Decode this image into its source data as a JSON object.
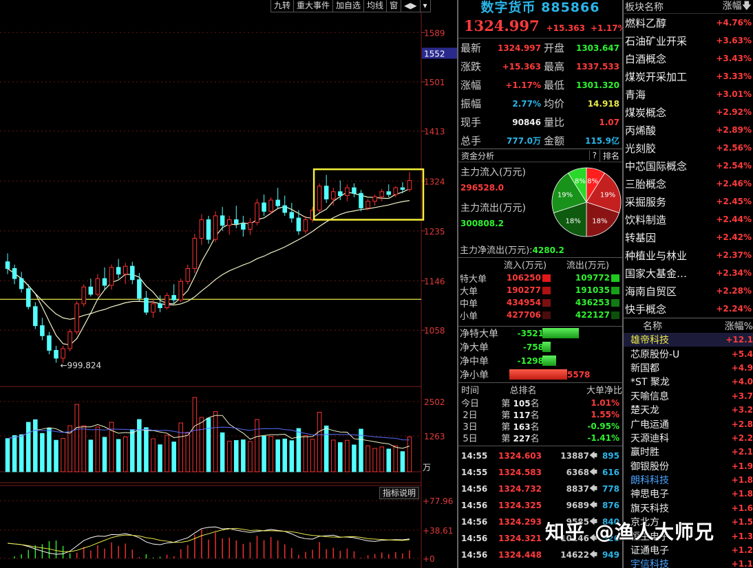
{
  "toolbar": [
    "九转",
    "重大事件",
    "加自选",
    "均线",
    "窗",
    "◀▶",
    "▾"
  ],
  "indicator_button": "指标说明",
  "chart_data": {
    "type": "candlestick",
    "price_axis": {
      "ylim": [
        960,
        1620
      ],
      "ticks": [
        "1589",
        "1501",
        "1413",
        "1324",
        "1235",
        "1146",
        "1058"
      ],
      "highlight_label": "1552"
    },
    "low_annotation": "999.824",
    "reference_line": 1113,
    "candles": [
      [
        1180,
        1195,
        1158,
        1168
      ],
      [
        1168,
        1175,
        1140,
        1150
      ],
      [
        1150,
        1162,
        1125,
        1132
      ],
      [
        1132,
        1140,
        1095,
        1100
      ],
      [
        1100,
        1108,
        1060,
        1066
      ],
      [
        1066,
        1080,
        1040,
        1048
      ],
      [
        1048,
        1055,
        1015,
        1022
      ],
      [
        1022,
        1030,
        1000,
        1008
      ],
      [
        1008,
        1030,
        1000,
        1025
      ],
      [
        1025,
        1060,
        1020,
        1055
      ],
      [
        1055,
        1110,
        1050,
        1105
      ],
      [
        1105,
        1140,
        1100,
        1135
      ],
      [
        1135,
        1150,
        1118,
        1122
      ],
      [
        1122,
        1158,
        1118,
        1150
      ],
      [
        1150,
        1170,
        1130,
        1138
      ],
      [
        1138,
        1175,
        1130,
        1170
      ],
      [
        1170,
        1185,
        1150,
        1158
      ],
      [
        1158,
        1178,
        1140,
        1172
      ],
      [
        1172,
        1180,
        1140,
        1148
      ],
      [
        1148,
        1160,
        1110,
        1115
      ],
      [
        1115,
        1128,
        1085,
        1090
      ],
      [
        1090,
        1112,
        1080,
        1105
      ],
      [
        1105,
        1120,
        1090,
        1098
      ],
      [
        1098,
        1125,
        1095,
        1120
      ],
      [
        1120,
        1140,
        1105,
        1112
      ],
      [
        1112,
        1150,
        1108,
        1145
      ],
      [
        1145,
        1175,
        1140,
        1168
      ],
      [
        1168,
        1230,
        1160,
        1222
      ],
      [
        1222,
        1265,
        1210,
        1255
      ],
      [
        1255,
        1262,
        1212,
        1220
      ],
      [
        1220,
        1270,
        1215,
        1262
      ],
      [
        1262,
        1278,
        1235,
        1245
      ],
      [
        1245,
        1262,
        1228,
        1255
      ],
      [
        1255,
        1280,
        1240,
        1248
      ],
      [
        1248,
        1262,
        1225,
        1238
      ],
      [
        1238,
        1258,
        1228,
        1250
      ],
      [
        1250,
        1292,
        1245,
        1285
      ],
      [
        1285,
        1300,
        1262,
        1270
      ],
      [
        1270,
        1295,
        1265,
        1290
      ],
      [
        1290,
        1312,
        1275,
        1280
      ],
      [
        1280,
        1298,
        1262,
        1268
      ],
      [
        1268,
        1285,
        1250,
        1258
      ],
      [
        1258,
        1272,
        1228,
        1235
      ],
      [
        1235,
        1262,
        1230,
        1255
      ],
      [
        1255,
        1278,
        1250,
        1272
      ],
      [
        1272,
        1320,
        1268,
        1315
      ],
      [
        1315,
        1335,
        1285,
        1292
      ],
      [
        1292,
        1312,
        1280,
        1305
      ],
      [
        1305,
        1325,
        1290,
        1298
      ],
      [
        1298,
        1318,
        1288,
        1312
      ],
      [
        1312,
        1320,
        1295,
        1302
      ],
      [
        1302,
        1308,
        1270,
        1276
      ],
      [
        1276,
        1292,
        1272,
        1288
      ],
      [
        1288,
        1300,
        1280,
        1296
      ],
      [
        1296,
        1310,
        1288,
        1305
      ],
      [
        1305,
        1318,
        1295,
        1300
      ],
      [
        1300,
        1315,
        1295,
        1312
      ],
      [
        1312,
        1322,
        1302,
        1309
      ],
      [
        1309,
        1340,
        1305,
        1325
      ]
    ],
    "volume_axis": {
      "ticks": [
        "2502",
        "1263"
      ],
      "unit": "万"
    },
    "indicator_axis": {
      "ticks": [
        "+77.96",
        "+38.61",
        "+0"
      ]
    }
  },
  "quote": {
    "title": "数字货币 885866",
    "price": "1324.997",
    "change": "+15.363",
    "pct": "+1.17%",
    "rows": [
      {
        "l": "最新",
        "v": "1324.997",
        "vc": "red",
        "l2": "开盘",
        "v2": "1303.647",
        "v2c": "green"
      },
      {
        "l": "涨跌",
        "v": "+15.363",
        "vc": "red",
        "l2": "最高",
        "v2": "1337.533",
        "v2c": "red"
      },
      {
        "l": "涨幅",
        "v": "+1.17%",
        "vc": "red",
        "l2": "最低",
        "v2": "1301.320",
        "v2c": "green"
      },
      {
        "l": "振幅",
        "v": "2.77%",
        "vc": "cyan",
        "l2": "均价",
        "v2": "14.918",
        "v2c": "yellow"
      },
      {
        "l": "现手",
        "v": "90846",
        "vc": "white",
        "l2": "量比",
        "v2": "1.07",
        "v2c": "red"
      },
      {
        "l": "总手",
        "v": "777.0万",
        "vc": "cyan",
        "l2": "金额",
        "v2": "115.9亿",
        "v2c": "cyan"
      }
    ]
  },
  "fund": {
    "header": "资金分析",
    "help": "?",
    "rank": "排名",
    "inflow_label": "主力流入(万元)",
    "inflow": "296528.0",
    "outflow_label": "主力流出(万元)",
    "outflow": "300808.2",
    "net_label": "主力净流出(万元):",
    "net": "4280.2",
    "pie": [
      {
        "label": "8%",
        "value": 8,
        "color": "#ff1f1f"
      },
      {
        "label": "19%",
        "value": 19,
        "color": "#c42020"
      },
      {
        "label": "18%",
        "value": 18,
        "color": "#8a1414"
      },
      {
        "label": "18%",
        "value": 18,
        "color": "#0e5a0e"
      },
      {
        "label": "19%",
        "value": 19,
        "color": "#18921a"
      },
      {
        "label": "8%",
        "value": 8,
        "color": "#2ad82a"
      }
    ]
  },
  "flow_table": {
    "headers": [
      "流入(万元)",
      "流出(万元)"
    ],
    "rows": [
      {
        "n": "特大单",
        "a": "106250",
        "b": "109772",
        "sq1": "#e01818",
        "sq2": "#1ec81e"
      },
      {
        "n": "大单",
        "a": "190277",
        "b": "191035",
        "sq1": "#b01212",
        "sq2": "#17a017"
      },
      {
        "n": "中单",
        "a": "434954",
        "b": "436253",
        "sq1": "#7a1010",
        "sq2": "#127a12"
      },
      {
        "n": "小单",
        "a": "427706",
        "b": "422127",
        "sq1": "#4a0c0c",
        "sq2": "#0c500c"
      }
    ]
  },
  "net_table": [
    {
      "n": "净特大单",
      "v": "-3521",
      "vc": "green",
      "bar": 0.62,
      "side": "green"
    },
    {
      "n": "净大单",
      "v": "-758",
      "vc": "green",
      "bar": 0.14,
      "side": "green"
    },
    {
      "n": "净中单",
      "v": "-1298",
      "vc": "green",
      "bar": 0.23,
      "side": "green"
    },
    {
      "n": "净小单",
      "v": "5578",
      "vc": "red",
      "bar": 1.0,
      "side": "red"
    }
  ],
  "rank_table": {
    "headers": [
      "时间",
      "总排名",
      "大单净比"
    ],
    "rows": [
      {
        "d": "今日",
        "r": "105",
        "p": "1.01%",
        "pc": "red"
      },
      {
        "d": "2日",
        "r": "117",
        "p": "1.55%",
        "pc": "red"
      },
      {
        "d": "3日",
        "r": "163",
        "p": "-0.95%",
        "pc": "green"
      },
      {
        "d": "5日",
        "r": "227",
        "p": "-1.41%",
        "pc": "green"
      }
    ],
    "prefix": "第",
    "suffix": "名"
  },
  "ticks": [
    {
      "t": "14:55",
      "p": "1324.603",
      "v": "13887",
      "c": "895"
    },
    {
      "t": "14:55",
      "p": "1324.583",
      "v": "6368",
      "c": "616"
    },
    {
      "t": "14:56",
      "p": "1324.732",
      "v": "8837",
      "c": "778"
    },
    {
      "t": "14:56",
      "p": "1324.325",
      "v": "9689",
      "c": "876"
    },
    {
      "t": "14:56",
      "p": "1324.293",
      "v": "9585",
      "c": "840"
    },
    {
      "t": "14:56",
      "p": "1324.321",
      "v": "10146",
      "c": "926"
    },
    {
      "t": "14:56",
      "p": "1324.448",
      "v": "14622",
      "c": "949"
    }
  ],
  "sector": {
    "headers": [
      "板块名称",
      "涨幅"
    ],
    "rows": [
      {
        "n": "燃料乙醇",
        "p": "+4.76%"
      },
      {
        "n": "石油矿业开采",
        "p": "+3.63%"
      },
      {
        "n": "白酒概念",
        "p": "+3.43%"
      },
      {
        "n": "煤炭开采加工",
        "p": "+3.33%"
      },
      {
        "n": "青海",
        "p": "+3.01%"
      },
      {
        "n": "煤炭概念",
        "p": "+2.92%"
      },
      {
        "n": "丙烯酸",
        "p": "+2.89%"
      },
      {
        "n": "光刻胶",
        "p": "+2.56%"
      },
      {
        "n": "中芯国际概念",
        "p": "+2.54%"
      },
      {
        "n": "三胎概念",
        "p": "+2.46%"
      },
      {
        "n": "采掘服务",
        "p": "+2.45%"
      },
      {
        "n": "饮料制造",
        "p": "+2.44%"
      },
      {
        "n": "转基因",
        "p": "+2.42%"
      },
      {
        "n": "种植业与林业",
        "p": "+2.37%"
      },
      {
        "n": "国家大基金…",
        "p": "+2.34%"
      },
      {
        "n": "海南自贸区",
        "p": "+2.28%"
      },
      {
        "n": "快手概念",
        "p": "+2.24%"
      }
    ]
  },
  "stocks": {
    "headers": [
      "名称",
      "涨幅%"
    ],
    "rows": [
      {
        "n": "雄帝科技",
        "p": "+12.1",
        "cls": "sel"
      },
      {
        "n": "芯原股份-U",
        "p": "+5.4",
        "cls": ""
      },
      {
        "n": "新国都",
        "p": "+4.9",
        "cls": ""
      },
      {
        "n": "*ST 聚龙",
        "p": "+4.0",
        "cls": ""
      },
      {
        "n": "天喻信息",
        "p": "+3.7",
        "cls": ""
      },
      {
        "n": "楚天龙",
        "p": "+3.2",
        "cls": ""
      },
      {
        "n": "广电运通",
        "p": "+2.8",
        "cls": ""
      },
      {
        "n": "天源迪科",
        "p": "+2.2",
        "cls": ""
      },
      {
        "n": "赢时胜",
        "p": "+2.1",
        "cls": ""
      },
      {
        "n": "御银股份",
        "p": "+1.9",
        "cls": ""
      },
      {
        "n": "朗科科技",
        "p": "+1.8",
        "cls": "blue"
      },
      {
        "n": "神思电子",
        "p": "+1.8",
        "cls": ""
      },
      {
        "n": "旗天科技",
        "p": "+1.6",
        "cls": ""
      },
      {
        "n": "京北方",
        "p": "+1.5",
        "cls": ""
      },
      {
        "n": "恒生电子",
        "p": "+1.3",
        "cls": ""
      },
      {
        "n": "证通电子",
        "p": "+1.2",
        "cls": ""
      },
      {
        "n": "宇信科技",
        "p": "+1.1",
        "cls": "blue"
      }
    ]
  },
  "watermark": {
    "logo": "知乎",
    "author": "@渔人大师兄"
  }
}
